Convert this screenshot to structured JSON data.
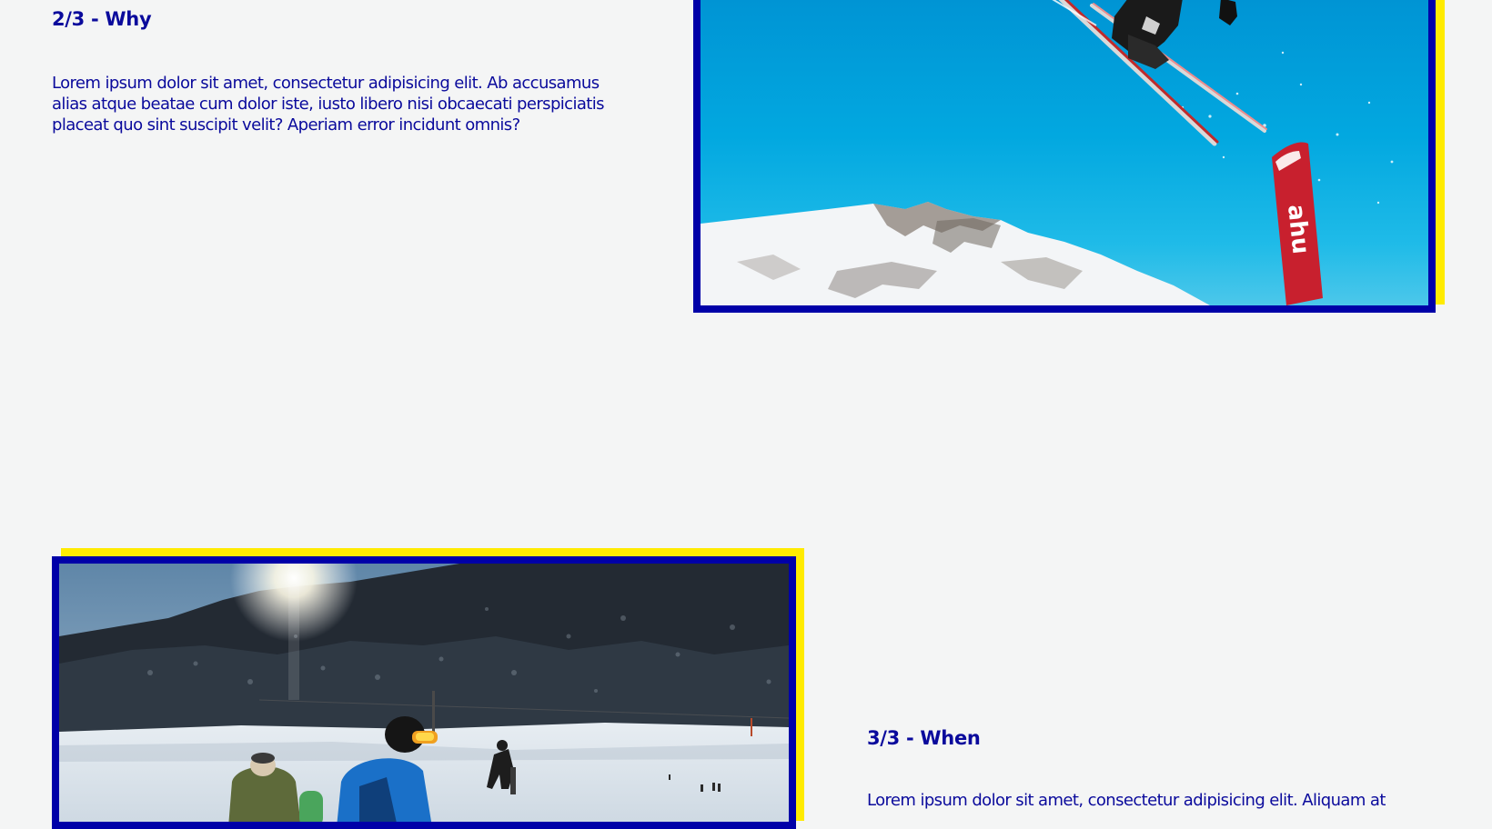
{
  "sections": [
    {
      "title": "2/3 - Why",
      "text": "Lorem ipsum dolor sit amet, consectetur adipisicing elit. Ab accusamus alias atque beatae cum dolor iste, iusto libero nisi obcaecati perspiciatis placeat quo sint suscipit velit? Aperiam error incidunt omnis?"
    },
    {
      "title": "3/3 - When",
      "text": "Lorem ipsum dolor sit amet, consectetur adipisicing elit. Aliquam at"
    }
  ],
  "colors": {
    "background": "#f4f5f5",
    "text": "#0a0a9c",
    "frame": "#0000a8",
    "accent": "#ffeb00"
  }
}
